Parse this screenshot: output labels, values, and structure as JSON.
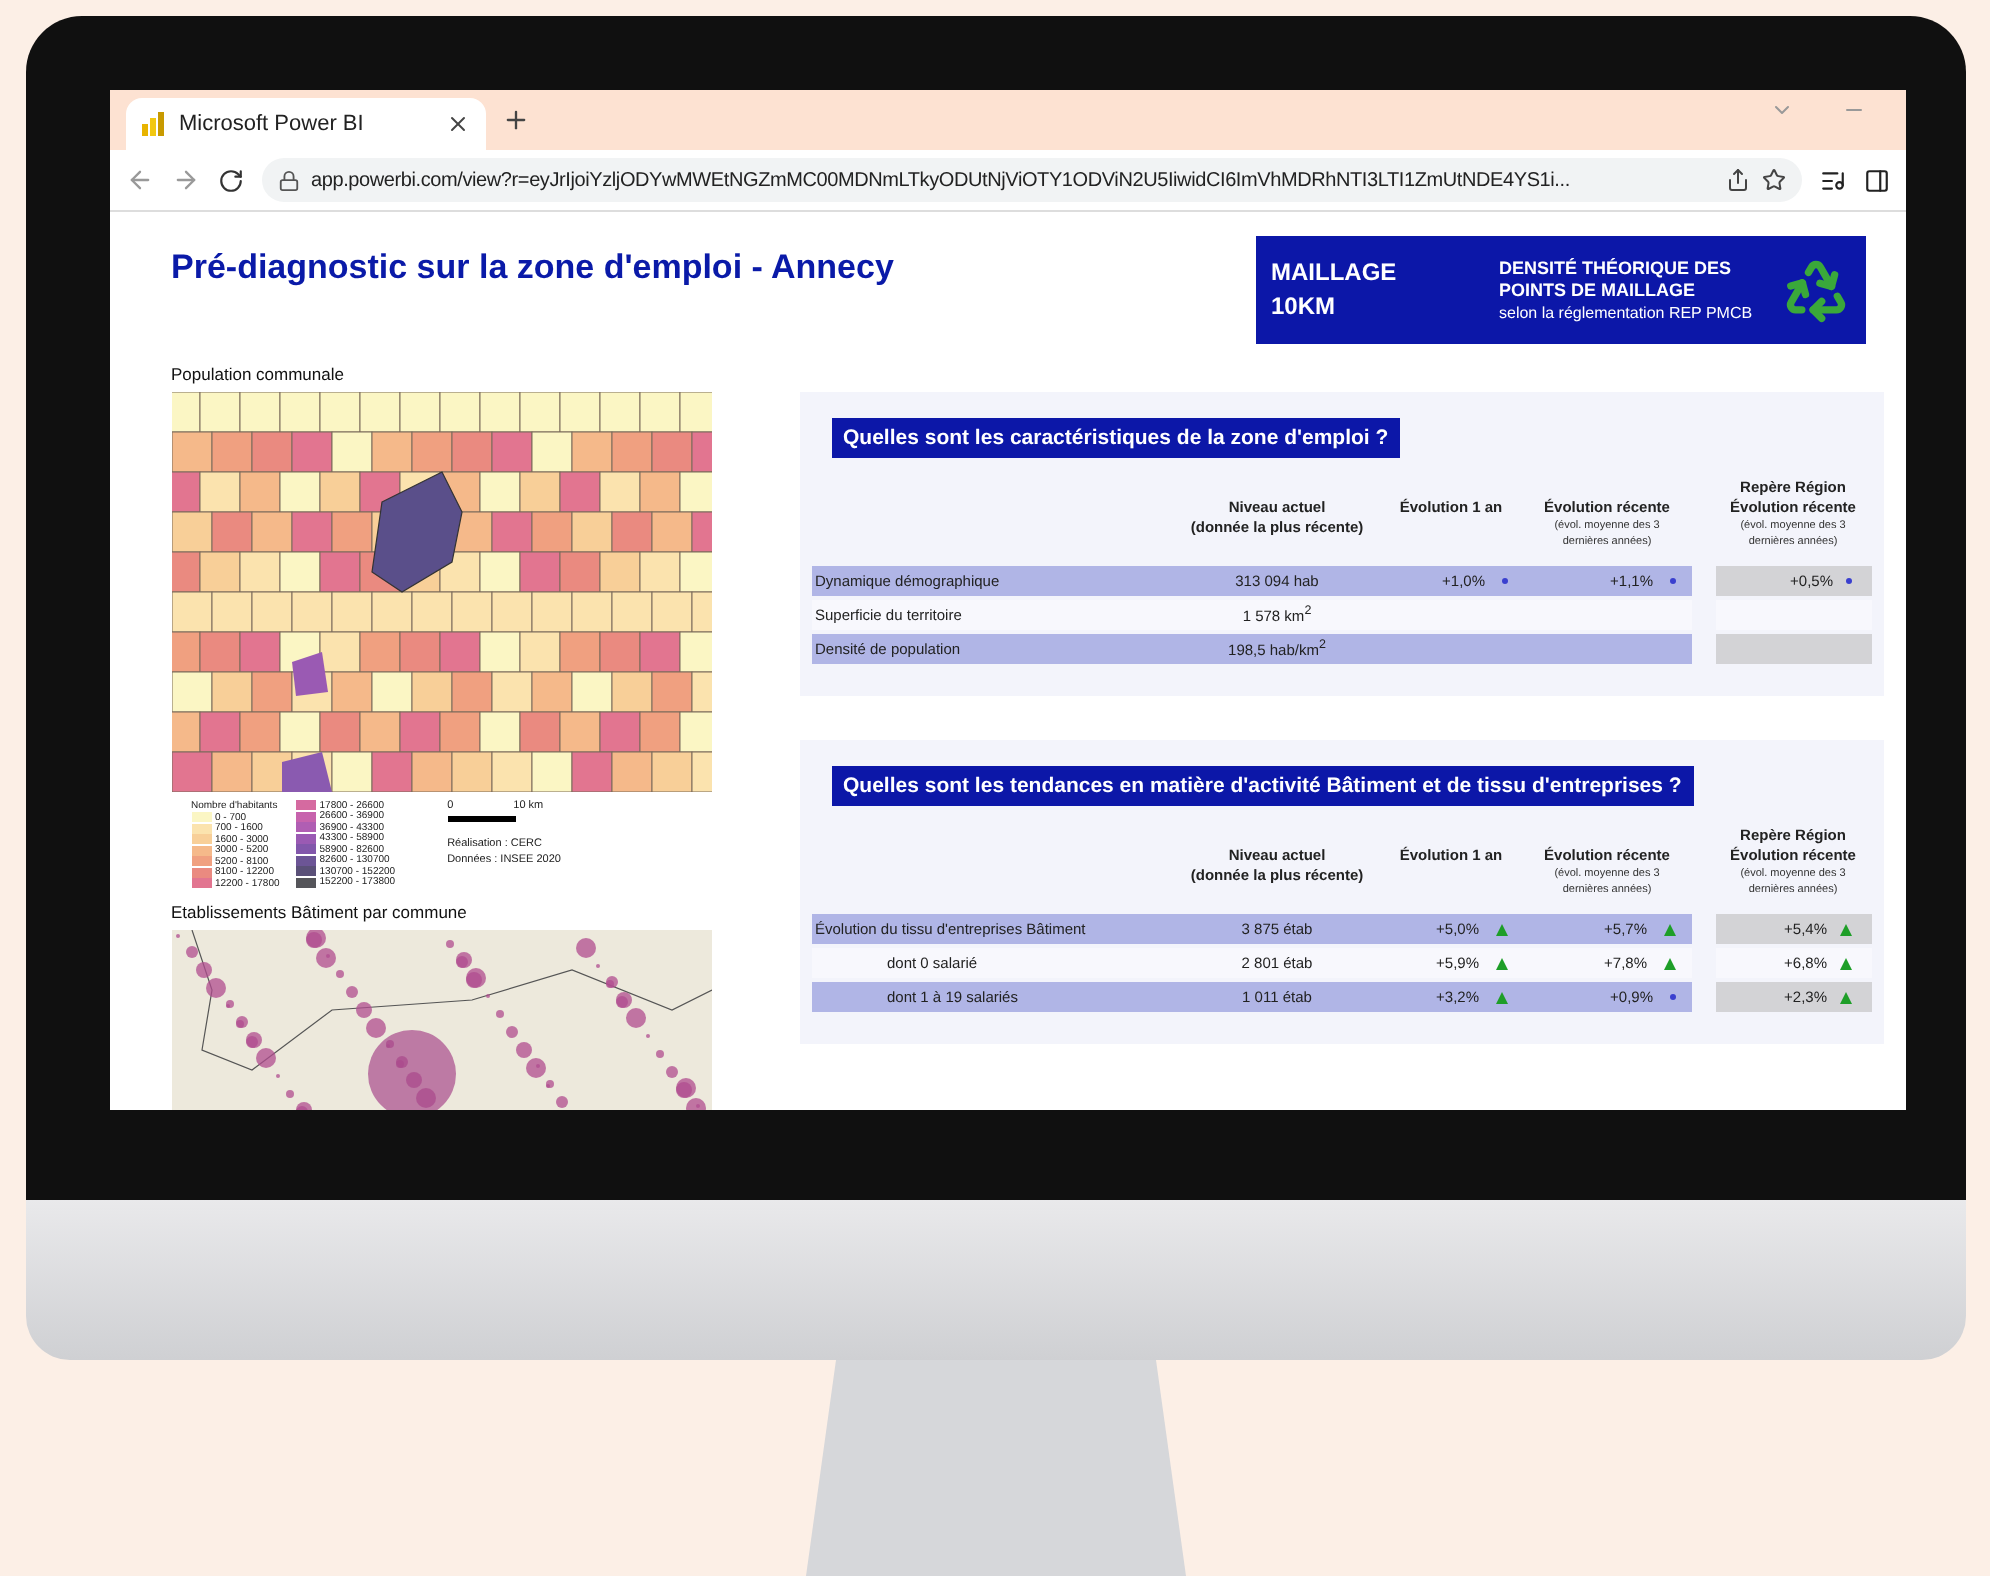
{
  "browser": {
    "tab_title": "Microsoft Power BI",
    "url": "app.powerbi.com/view?r=eyJrIjoiYzljODYwMWEtNGZmMC00MDNmLTkyODUtNjViOTY1ODViN2U5IiwidCI6ImVhMDRhNTI3LTI1ZmUtNDE4YS1i..."
  },
  "report": {
    "title": "Pré-diagnostic sur la zone d'emploi - Annecy",
    "banner": {
      "label_lines": [
        "MAILLAGE",
        "10KM"
      ],
      "title_lines": [
        "DENSITÉ THÉORIQUE DES",
        "POINTS DE MAILLAGE"
      ],
      "subtitle": "selon la réglementation REP PMCB"
    },
    "maps": [
      {
        "kind": "choropleth",
        "title": "Population communale",
        "legend_title": "Nombre d'habitants",
        "legend": [
          {
            "label": "0 - 700",
            "color": "#fbf6c4"
          },
          {
            "label": "700 - 1600",
            "color": "#fbe3ae"
          },
          {
            "label": "1600 - 3000",
            "color": "#f8cf98"
          },
          {
            "label": "3000 - 5200",
            "color": "#f5b98a"
          },
          {
            "label": "5200 - 8100",
            "color": "#f0a080"
          },
          {
            "label": "8100 - 12200",
            "color": "#ea8a80"
          },
          {
            "label": "12200 - 17800",
            "color": "#e27590"
          },
          {
            "label": "17800 - 26600",
            "color": "#d56aa0"
          },
          {
            "label": "26600 - 36900",
            "color": "#c763ad"
          },
          {
            "label": "36900 - 43300",
            "color": "#b05eb3"
          },
          {
            "label": "43300 - 58900",
            "color": "#9a5ab3"
          },
          {
            "label": "58900 - 82600",
            "color": "#8257ab"
          },
          {
            "label": "82600 - 130700",
            "color": "#6c5596"
          },
          {
            "label": "130700 - 152200",
            "color": "#5a5078"
          },
          {
            "label": "152200 - 173800",
            "color": "#55555a"
          }
        ],
        "scale": [
          "0",
          "10 km"
        ],
        "credits": [
          "Réalisation : CERC",
          "Données : INSEE 2020"
        ]
      },
      {
        "kind": "bubbles",
        "title": "Etablissements Bâtiment par commune"
      }
    ],
    "sections": [
      {
        "title": "Quelles sont les caractéristiques de la zone d'emploi ?",
        "columns": [
          {
            "title": "Niveau actuel\n(donnée la plus récente)"
          },
          {
            "title": "Évolution 1 an"
          },
          {
            "title": "Évolution récente",
            "note": "(évol. moyenne des 3\ndernières années)"
          },
          {
            "title": "Repère Région\nÉvolution récente",
            "note": "(évol. moyenne des 3\ndernières années)"
          }
        ],
        "rows": [
          {
            "label": "Dynamique démographique",
            "highlighted": true,
            "level": "313 094 hab",
            "evo_1an": {
              "value": "+1,0%",
              "up": false
            },
            "evo_recente": {
              "value": "+1,1%",
              "up": false
            },
            "region": {
              "value": "+0,5%",
              "up": false
            }
          },
          {
            "label": "Superficie du territoire",
            "highlighted": false,
            "level": "1 578 km$^{2}$"
          },
          {
            "label": "Densité de population",
            "highlighted": true,
            "level": "198,5 hab/km$^{2}$"
          }
        ]
      },
      {
        "title": "Quelles sont les tendances en matière d'activité Bâtiment et de tissu d'entreprises ?",
        "columns": [
          {
            "title": "Niveau actuel\n(donnée la plus récente)"
          },
          {
            "title": "Évolution 1 an"
          },
          {
            "title": "Évolution récente",
            "note": "(évol. moyenne des 3\ndernières années)"
          },
          {
            "title": "Repère Région\nÉvolution récente",
            "note": "(évol. moyenne des 3\ndernières années)"
          }
        ],
        "rows": [
          {
            "label": "Évolution du tissu d'entreprises Bâtiment",
            "highlighted": true,
            "level": "3 875 étab",
            "evo_1an": {
              "value": "+5,0%",
              "up": true
            },
            "evo_recente": {
              "value": "+5,7%",
              "up": true
            },
            "region": {
              "value": "+5,4%",
              "up": true
            },
            "children": [
              {
                "label": "dont 0 salarié",
                "highlighted": false,
                "level": "2 801 étab",
                "evo_1an": {
                  "value": "+5,9%",
                  "up": true
                },
                "evo_recente": {
                  "value": "+7,8%",
                  "up": true
                },
                "region": {
                  "value": "+6,8%",
                  "up": true
                }
              },
              {
                "label": "dont 1 à 19 salariés",
                "highlighted": true,
                "level": "1 011 étab",
                "evo_1an": {
                  "value": "+3,2%",
                  "up": true
                },
                "evo_recente": {
                  "value": "+0,9%",
                  "up": false
                },
                "region": {
                  "value": "+2,3%",
                  "up": true
                }
              }
            ]
          }
        ]
      }
    ]
  }
}
